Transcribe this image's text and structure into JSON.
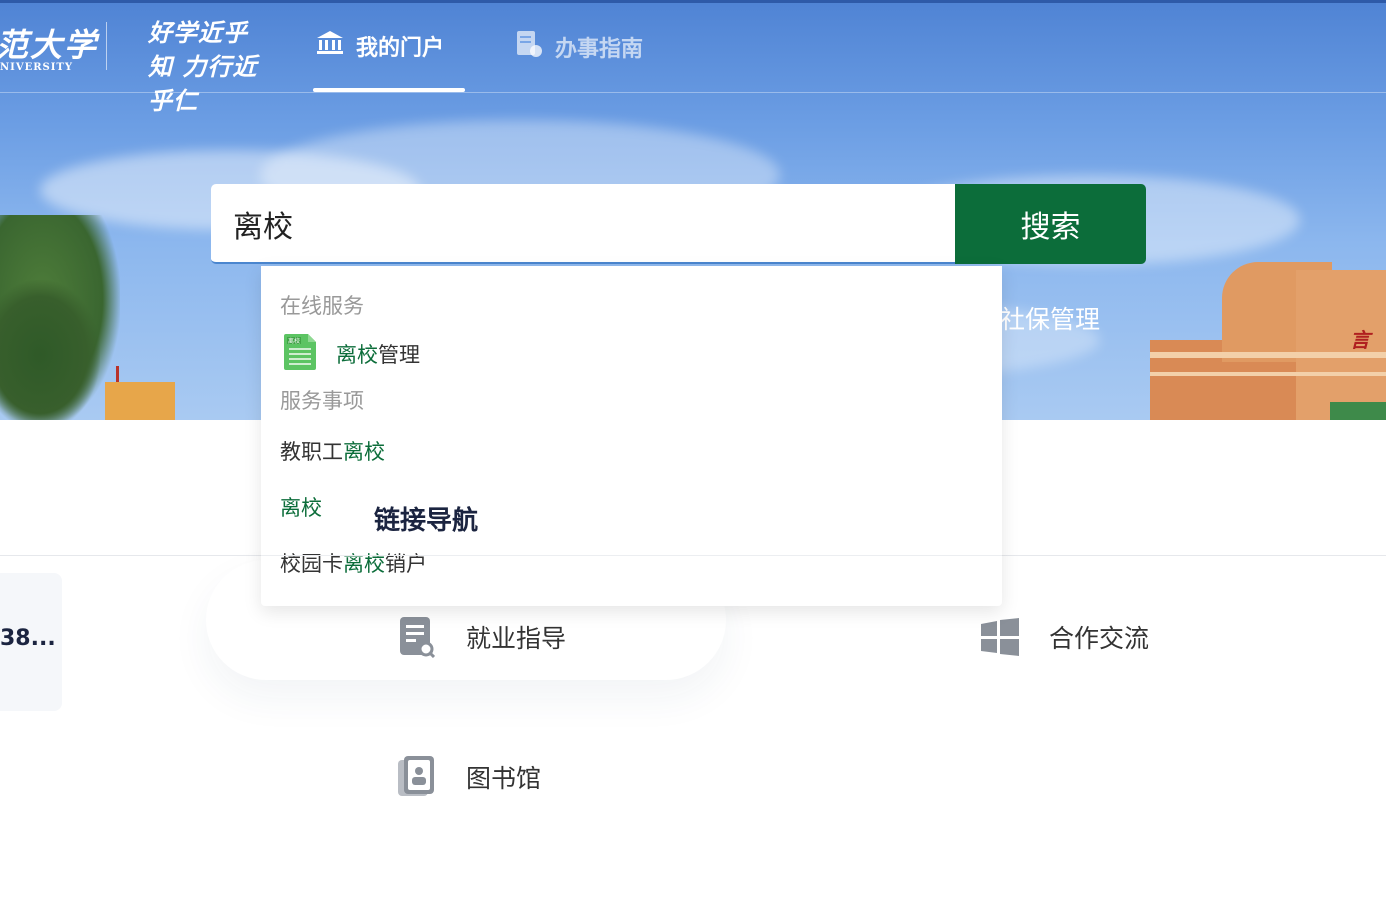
{
  "header": {
    "logo_text": "范大学",
    "logo_sub": "NIVERSITY",
    "motto": "好学近乎知 力行近乎仁",
    "nav": [
      {
        "label": "我的门户",
        "icon": "bank-icon",
        "active": true
      },
      {
        "label": "办事指南",
        "icon": "document-icon",
        "active": false
      }
    ]
  },
  "hero": {
    "tag_text": "社保管理",
    "building_sign": "言"
  },
  "search": {
    "value": "离校",
    "button_label": "搜索"
  },
  "suggestions": {
    "online_section": "在线服务",
    "online_items": [
      {
        "highlight": "离校",
        "rest": "管理",
        "icon": "green-doc-icon",
        "icon_label": "离校"
      }
    ],
    "matter_section": "服务事项",
    "matter_items": [
      {
        "prefix": "教职工",
        "highlight": "离校",
        "suffix": ""
      },
      {
        "prefix": "",
        "highlight": "离校",
        "suffix": ""
      },
      {
        "prefix": "校园卡",
        "highlight": "离校",
        "suffix": "销户"
      }
    ]
  },
  "link_nav": {
    "title": "链接导航",
    "left_card_text": "38...",
    "items": [
      {
        "label": "就业指导",
        "icon": "job-guide-icon"
      },
      {
        "label": "合作交流",
        "icon": "windows-grid-icon"
      },
      {
        "label": "图书馆",
        "icon": "library-icon"
      }
    ]
  },
  "colors": {
    "brand_green": "#0c6d3a",
    "hero_blue": "#4f83d4",
    "text_dark": "#1b2440"
  }
}
